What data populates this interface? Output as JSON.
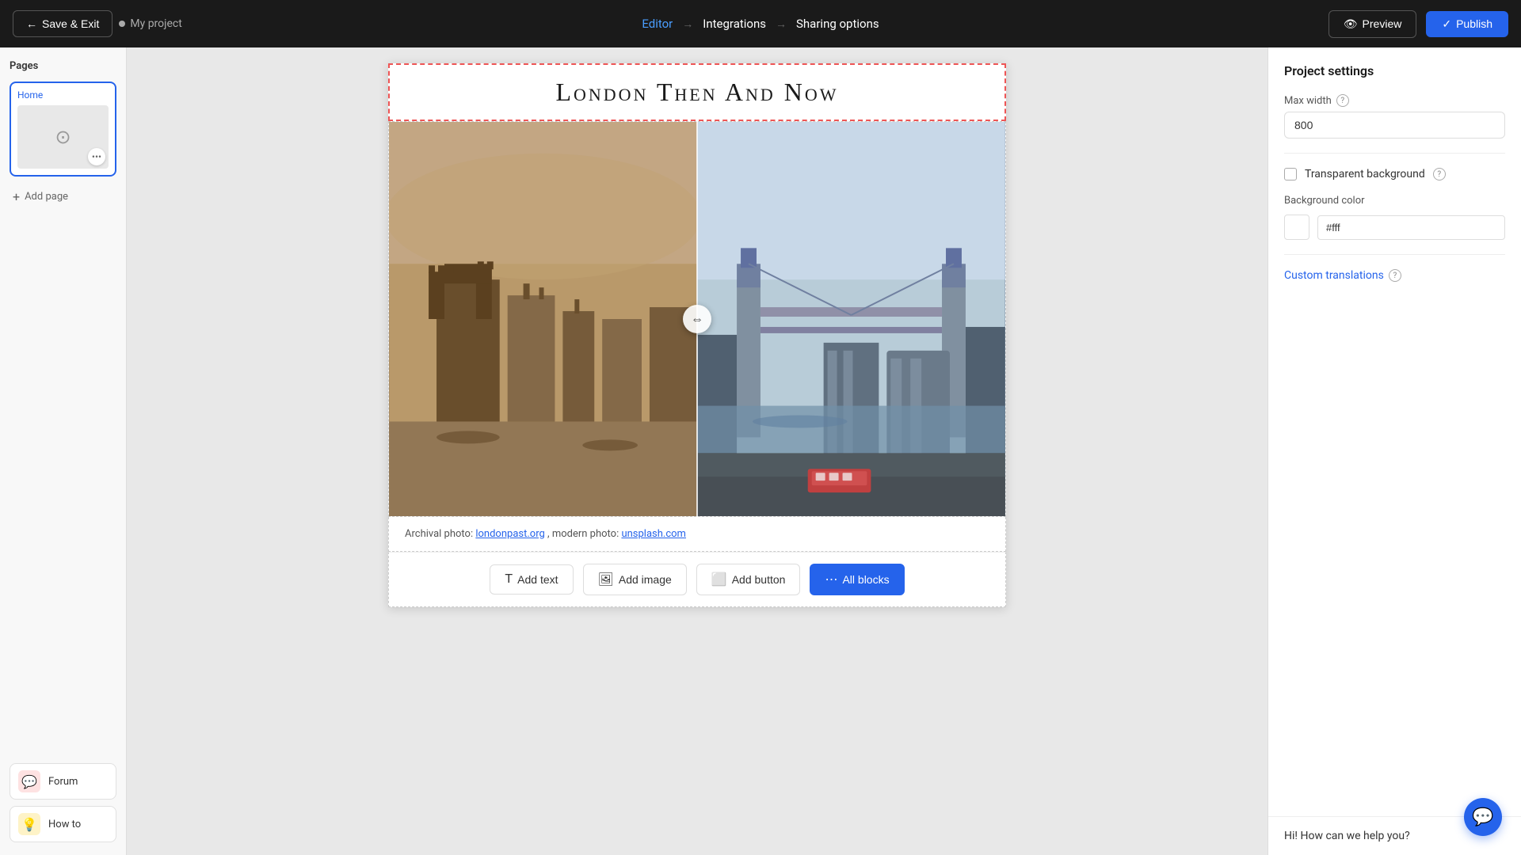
{
  "navbar": {
    "save_exit_label": "Save & Exit",
    "project_name": "My project",
    "nav_editor": "Editor",
    "nav_integrations": "Integrations",
    "nav_sharing": "Sharing options",
    "preview_label": "Preview",
    "publish_label": "Publish",
    "arrow": "→"
  },
  "sidebar": {
    "pages_title": "Pages",
    "home_page_label": "Home",
    "add_page_label": "Add page",
    "tools": [
      {
        "id": "forum",
        "label": "Forum",
        "icon": "💬",
        "type": "forum"
      },
      {
        "id": "howto",
        "label": "How to",
        "icon": "💡",
        "type": "howto"
      }
    ]
  },
  "canvas": {
    "title": "London Then And Now",
    "caption_prefix": "Archival photo: ",
    "caption_link1_text": "londonpast.org",
    "caption_separator": ", modern photo: ",
    "caption_link2_text": "unsplash.com"
  },
  "toolbar": {
    "add_text_label": "Add text",
    "add_image_label": "Add image",
    "add_button_label": "Add button",
    "all_blocks_label": "All blocks"
  },
  "settings": {
    "panel_title": "Project settings",
    "max_width_label": "Max width",
    "max_width_help": "?",
    "max_width_value": "800",
    "transparent_bg_label": "Transparent background",
    "transparent_bg_help": "?",
    "bg_color_label": "Background color",
    "bg_color_value": "#fff",
    "custom_translations_label": "Custom translations",
    "custom_translations_help": "?"
  },
  "chat": {
    "message": "Hi! How can we help you?"
  },
  "icons": {
    "back_arrow": "←",
    "check": "✓",
    "eye": "👁",
    "dots": "•••",
    "arrows_lr": "⇔",
    "plus": "+",
    "chat_bubble": "💬",
    "minus": "−"
  }
}
